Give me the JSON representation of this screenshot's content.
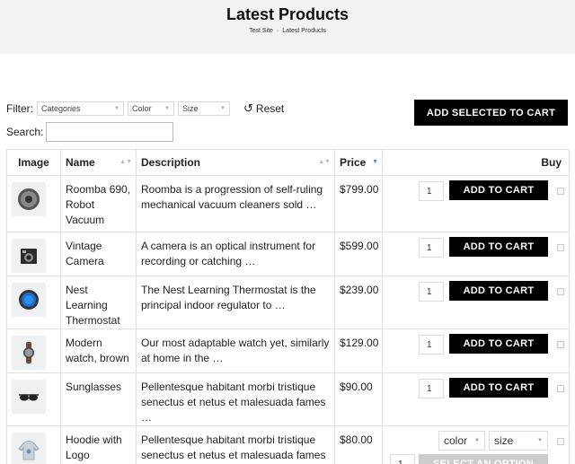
{
  "header": {
    "title": "Latest Products",
    "breadcrumbs": [
      "Test Site",
      "Latest Products"
    ],
    "separator": "›"
  },
  "filters": {
    "label": "Filter:",
    "selects": [
      {
        "name": "categories",
        "value": "Categories"
      },
      {
        "name": "color",
        "value": "Color"
      },
      {
        "name": "size",
        "value": "Size"
      }
    ],
    "reset_label": "Reset"
  },
  "add_selected_label": "ADD SELECTED TO CART",
  "search": {
    "label": "Search:",
    "value": ""
  },
  "table": {
    "columns": [
      "Image",
      "Name",
      "Description",
      "Price",
      "Buy"
    ],
    "rows": [
      {
        "name": "Roomba 690, Robot Vacuum",
        "description": "Roomba is a progression of self-ruling mechanical vacuum cleaners sold …",
        "price": "$799.00",
        "qty": "1",
        "action": "ADD TO CART",
        "icon": "robot-vacuum-icon"
      },
      {
        "name": "Vintage Camera",
        "description": "A camera is an optical instrument for recording or catching …",
        "price": "$599.00",
        "qty": "1",
        "action": "ADD TO CART",
        "icon": "camera-icon"
      },
      {
        "name": "Nest Learning Thermostat",
        "description": "The Nest Learning Thermostat is the principal indoor regulator to …",
        "price": "$239.00",
        "qty": "1",
        "action": "ADD TO CART",
        "icon": "thermostat-icon"
      },
      {
        "name": "Modern watch, brown",
        "description": "Our most adaptable watch yet, similarly at home in the …",
        "price": "$129.00",
        "qty": "1",
        "action": "ADD TO CART",
        "icon": "watch-icon"
      },
      {
        "name": "Sunglasses",
        "description": "Pellentesque habitant morbi tristique senectus et netus et malesuada fames …",
        "price": "$90.00",
        "qty": "1",
        "action": "ADD TO CART",
        "icon": "sunglasses-icon"
      },
      {
        "name": "Hoodie with Logo",
        "description": "Pellentesque habitant morbi tristique senectus et netus et malesuada fames …",
        "price": "$80.00",
        "qty": "1",
        "action": "SELECT AN OPTION",
        "icon": "hoodie-icon",
        "variation": {
          "color": "color",
          "size": "size"
        }
      }
    ]
  },
  "colors": {
    "button": "#000000",
    "disabled_button": "#cccccc",
    "sort_active": "#4a8fd6",
    "header_bg": "#f2f2f2"
  }
}
